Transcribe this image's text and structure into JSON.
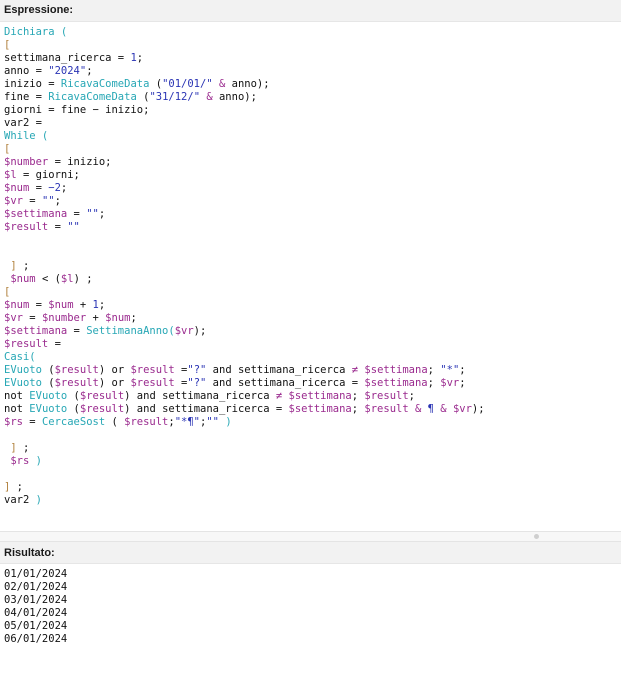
{
  "expression": {
    "header": "Espressione:",
    "lines": [
      [
        {
          "t": "Dichiara (",
          "c": "kw"
        }
      ],
      [
        {
          "t": "[",
          "c": "br"
        }
      ],
      [
        {
          "t": "settimana_ricerca = "
        },
        {
          "t": "1",
          "c": "num"
        },
        {
          "t": ";"
        }
      ],
      [
        {
          "t": "anno = "
        },
        {
          "t": "\"2024\"",
          "c": "str"
        },
        {
          "t": ";"
        }
      ],
      [
        {
          "t": "inizio = "
        },
        {
          "t": "RicavaComeData",
          "c": "fn"
        },
        {
          "t": " ("
        },
        {
          "t": "\"01/01/\"",
          "c": "str"
        },
        {
          "t": " & ",
          "c": "op"
        },
        {
          "t": "anno);"
        }
      ],
      [
        {
          "t": "fine = "
        },
        {
          "t": "RicavaComeData",
          "c": "fn"
        },
        {
          "t": " ("
        },
        {
          "t": "\"31/12/\"",
          "c": "str"
        },
        {
          "t": " & ",
          "c": "op"
        },
        {
          "t": "anno);"
        }
      ],
      [
        {
          "t": "giorni = fine − inizio;"
        }
      ],
      [
        {
          "t": "var2 ="
        }
      ],
      [
        {
          "t": "While (",
          "c": "kw"
        }
      ],
      [
        {
          "t": "[",
          "c": "br"
        }
      ],
      [
        {
          "t": "$number",
          "c": "var"
        },
        {
          "t": " = inizio;"
        }
      ],
      [
        {
          "t": "$l",
          "c": "var"
        },
        {
          "t": " = giorni;"
        }
      ],
      [
        {
          "t": "$num",
          "c": "var"
        },
        {
          "t": " = "
        },
        {
          "t": "−2",
          "c": "num"
        },
        {
          "t": ";"
        }
      ],
      [
        {
          "t": "$vr",
          "c": "var"
        },
        {
          "t": " = "
        },
        {
          "t": "\"\"",
          "c": "str"
        },
        {
          "t": ";"
        }
      ],
      [
        {
          "t": "$settimana",
          "c": "var"
        },
        {
          "t": " = "
        },
        {
          "t": "\"\"",
          "c": "str"
        },
        {
          "t": ";"
        }
      ],
      [
        {
          "t": "$result",
          "c": "var"
        },
        {
          "t": " = "
        },
        {
          "t": "\"\"",
          "c": "str"
        }
      ],
      [],
      [],
      [
        {
          "t": " "
        },
        {
          "t": "]",
          "c": "br"
        },
        {
          "t": " ;"
        }
      ],
      [
        {
          "t": " "
        },
        {
          "t": "$num",
          "c": "var"
        },
        {
          "t": " < ("
        },
        {
          "t": "$l",
          "c": "var"
        },
        {
          "t": ") ;"
        }
      ],
      [
        {
          "t": "[",
          "c": "br"
        }
      ],
      [
        {
          "t": "$num",
          "c": "var"
        },
        {
          "t": " = "
        },
        {
          "t": "$num",
          "c": "var"
        },
        {
          "t": " + "
        },
        {
          "t": "1",
          "c": "num"
        },
        {
          "t": ";"
        }
      ],
      [
        {
          "t": "$vr",
          "c": "var"
        },
        {
          "t": " = "
        },
        {
          "t": "$number",
          "c": "var"
        },
        {
          "t": " + "
        },
        {
          "t": "$num",
          "c": "var"
        },
        {
          "t": ";"
        }
      ],
      [
        {
          "t": "$settimana",
          "c": "var"
        },
        {
          "t": " = "
        },
        {
          "t": "SettimanaAnno(",
          "c": "fn"
        },
        {
          "t": "$vr",
          "c": "var"
        },
        {
          "t": ");"
        }
      ],
      [
        {
          "t": "$result",
          "c": "var"
        },
        {
          "t": " ="
        }
      ],
      [
        {
          "t": "Casi(",
          "c": "kw"
        }
      ],
      [
        {
          "t": "EVuoto",
          "c": "fn"
        },
        {
          "t": " ("
        },
        {
          "t": "$result",
          "c": "var"
        },
        {
          "t": ") or "
        },
        {
          "t": "$result",
          "c": "var"
        },
        {
          "t": " ="
        },
        {
          "t": "\"?\"",
          "c": "str"
        },
        {
          "t": " and settimana_ricerca "
        },
        {
          "t": "≠",
          "c": "op"
        },
        {
          "t": " "
        },
        {
          "t": "$settimana",
          "c": "var"
        },
        {
          "t": "; "
        },
        {
          "t": "\"*\"",
          "c": "str"
        },
        {
          "t": ";"
        }
      ],
      [
        {
          "t": "EVuoto",
          "c": "fn"
        },
        {
          "t": " ("
        },
        {
          "t": "$result",
          "c": "var"
        },
        {
          "t": ") or "
        },
        {
          "t": "$result",
          "c": "var"
        },
        {
          "t": " ="
        },
        {
          "t": "\"?\"",
          "c": "str"
        },
        {
          "t": " and settimana_ricerca = "
        },
        {
          "t": "$settimana",
          "c": "var"
        },
        {
          "t": "; "
        },
        {
          "t": "$vr",
          "c": "var"
        },
        {
          "t": ";"
        }
      ],
      [
        {
          "t": "not "
        },
        {
          "t": "EVuoto",
          "c": "fn"
        },
        {
          "t": " ("
        },
        {
          "t": "$result",
          "c": "var"
        },
        {
          "t": ") and settimana_ricerca "
        },
        {
          "t": "≠",
          "c": "op"
        },
        {
          "t": " "
        },
        {
          "t": "$settimana",
          "c": "var"
        },
        {
          "t": "; "
        },
        {
          "t": "$result",
          "c": "var"
        },
        {
          "t": ";"
        }
      ],
      [
        {
          "t": "not "
        },
        {
          "t": "EVuoto",
          "c": "fn"
        },
        {
          "t": " ("
        },
        {
          "t": "$result",
          "c": "var"
        },
        {
          "t": ") and settimana_ricerca = "
        },
        {
          "t": "$settimana",
          "c": "var"
        },
        {
          "t": "; "
        },
        {
          "t": "$result",
          "c": "var"
        },
        {
          "t": " & ",
          "c": "op"
        },
        {
          "t": "¶",
          "c": "str"
        },
        {
          "t": " & ",
          "c": "op"
        },
        {
          "t": "$vr",
          "c": "var"
        },
        {
          "t": ");"
        }
      ],
      [
        {
          "t": "$rs",
          "c": "var"
        },
        {
          "t": " = "
        },
        {
          "t": "CercaeSost",
          "c": "fn"
        },
        {
          "t": " ( "
        },
        {
          "t": "$result",
          "c": "var"
        },
        {
          "t": ";"
        },
        {
          "t": "\"*¶\"",
          "c": "str"
        },
        {
          "t": ";"
        },
        {
          "t": "\"\"",
          "c": "str"
        },
        {
          "t": " )",
          "c": "kw"
        }
      ],
      [],
      [
        {
          "t": " "
        },
        {
          "t": "]",
          "c": "br"
        },
        {
          "t": " ;"
        }
      ],
      [
        {
          "t": " "
        },
        {
          "t": "$rs",
          "c": "var"
        },
        {
          "t": " )",
          "c": "kw"
        }
      ],
      [],
      [
        {
          "t": "]",
          "c": "br"
        },
        {
          "t": " ;"
        }
      ],
      [
        {
          "t": "var2"
        },
        {
          "t": " )",
          "c": "kw"
        }
      ]
    ]
  },
  "result": {
    "header": "Risultato:",
    "lines": [
      "01/01/2024",
      "02/01/2024",
      "03/01/2024",
      "04/01/2024",
      "05/01/2024",
      "06/01/2024"
    ]
  }
}
